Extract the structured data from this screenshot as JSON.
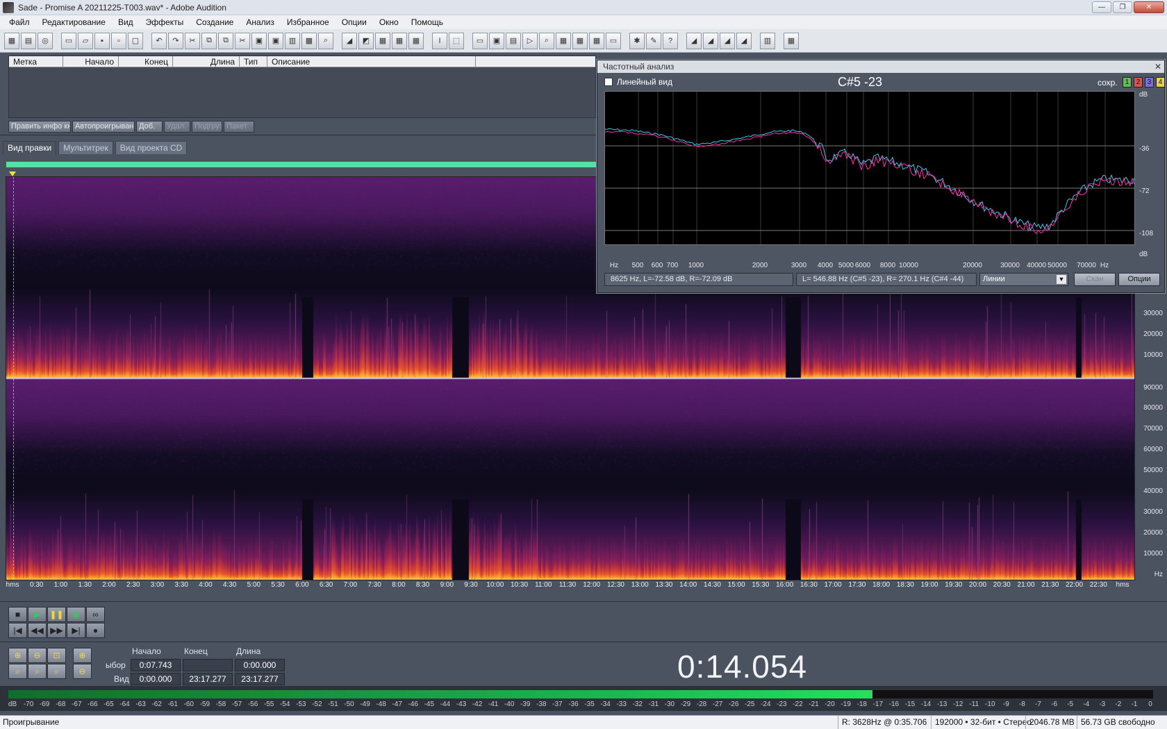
{
  "window": {
    "title": "Sade - Promise  A 20211225-T003.wav* - Adobe Audition",
    "min": "—",
    "max": "❐",
    "close": "✕"
  },
  "menu": [
    "Файл",
    "Редактирование",
    "Вид",
    "Эффекты",
    "Создание",
    "Анализ",
    "Избранное",
    "Опции",
    "Окно",
    "Помощь"
  ],
  "markers": {
    "columns": [
      "Метка",
      "Начало",
      "Конец",
      "Длина",
      "Тип",
      "Описание"
    ],
    "buttons": [
      {
        "label": "Править инфо кн",
        "enabled": true
      },
      {
        "label": "Автопроигрывани",
        "enabled": true
      },
      {
        "label": "Доб.",
        "enabled": true
      },
      {
        "label": "Удал.",
        "enabled": false
      },
      {
        "label": "Подгруз",
        "enabled": false
      },
      {
        "label": "Пакет",
        "enabled": false
      }
    ]
  },
  "view_tabs": [
    "Вид правки",
    "Мультитрек",
    "Вид проекта CD"
  ],
  "freq_axis_top": [
    "30000",
    "20000",
    "10000"
  ],
  "freq_axis_bottom": [
    "90000",
    "80000",
    "70000",
    "60000",
    "50000",
    "40000",
    "30000",
    "20000",
    "10000",
    "Hz"
  ],
  "time_axis": [
    "hms",
    "0:30",
    "1:00",
    "1:30",
    "2:00",
    "2:30",
    "3:00",
    "3:30",
    "4:00",
    "4:30",
    "5:00",
    "5:30",
    "6:00",
    "6:30",
    "7:00",
    "7:30",
    "8:00",
    "8:30",
    "9:00",
    "9:30",
    "10:00",
    "10:30",
    "11:00",
    "11:30",
    "12:00",
    "12:30",
    "13:00",
    "13:30",
    "14:00",
    "14:30",
    "15:00",
    "15:30",
    "16:00",
    "16:30",
    "17:00",
    "17:30",
    "18:00",
    "18:30",
    "19:00",
    "19:30",
    "20:00",
    "20:30",
    "21:00",
    "21:30",
    "22:00",
    "22:30",
    "hms"
  ],
  "selection": {
    "headers": [
      "Начало",
      "Конец",
      "Длина"
    ],
    "row1_label": "ыбор",
    "row1": [
      "0:07.743",
      "",
      "0:00.000"
    ],
    "row2_label": "Вид",
    "row2": [
      "0:00.000",
      "23:17.277",
      "23:17.277"
    ]
  },
  "time_display": "0:14.054",
  "meter": {
    "scale": [
      "dB",
      "-70",
      "-69",
      "-68",
      "-67",
      "-66",
      "-65",
      "-64",
      "-63",
      "-62",
      "-61",
      "-60",
      "-59",
      "-58",
      "-57",
      "-56",
      "-55",
      "-54",
      "-53",
      "-52",
      "-51",
      "-50",
      "-49",
      "-48",
      "-47",
      "-46",
      "-45",
      "-44",
      "-43",
      "-42",
      "-41",
      "-40",
      "-39",
      "-38",
      "-37",
      "-36",
      "-35",
      "-34",
      "-33",
      "-32",
      "-31",
      "-30",
      "-29",
      "-28",
      "-27",
      "-26",
      "-25",
      "-24",
      "-23",
      "-22",
      "-21",
      "-20",
      "-19",
      "-18",
      "-17",
      "-16",
      "-15",
      "-14",
      "-13",
      "-12",
      "-11",
      "-10",
      "-9",
      "-8",
      "-7",
      "-6",
      "-5",
      "-4",
      "-3",
      "-2",
      "-1",
      "0"
    ],
    "level_fraction": 0.755
  },
  "status": {
    "left": "Проигрывание",
    "segments": [
      "R: 3628Hz @   0:35.706",
      "192000 • 32-бит • Стерео",
      "2046.78 MB",
      "56.73 GB свободно"
    ]
  },
  "freq_analysis": {
    "title": "Частотный анализ",
    "close": "✕",
    "linear_label": "Линейный вид",
    "note": "C#5 -23",
    "save_label": "сохр.",
    "slots": [
      {
        "n": "1",
        "color": "#5fbf4f"
      },
      {
        "n": "2",
        "color": "#e05050"
      },
      {
        "n": "3",
        "color": "#7a6ee6"
      },
      {
        "n": "4",
        "color": "#e8d050"
      }
    ],
    "db_labels": [
      "dB",
      "-36",
      "-72",
      "-108",
      "dB"
    ],
    "hz_labels": [
      "Hz",
      "500",
      "600",
      "700",
      "1000",
      "2000",
      "3000",
      "4000",
      "5000",
      "6000",
      "8000",
      "10000",
      "20000",
      "30000",
      "40000",
      "50000",
      "70000",
      "Hz"
    ],
    "cursor_readout": "8625 Hz, L=-72.58 dB, R=-72.09 dB",
    "peak_readout": "L= 546.88 Hz (C#5 -23), R=  270.1 Hz (C#4 -44)",
    "mode": "Линии",
    "scan_label": "Скан",
    "options_label": "Опции",
    "colors": {
      "left": "#ff2fa8",
      "right": "#3fc8e8"
    }
  }
}
